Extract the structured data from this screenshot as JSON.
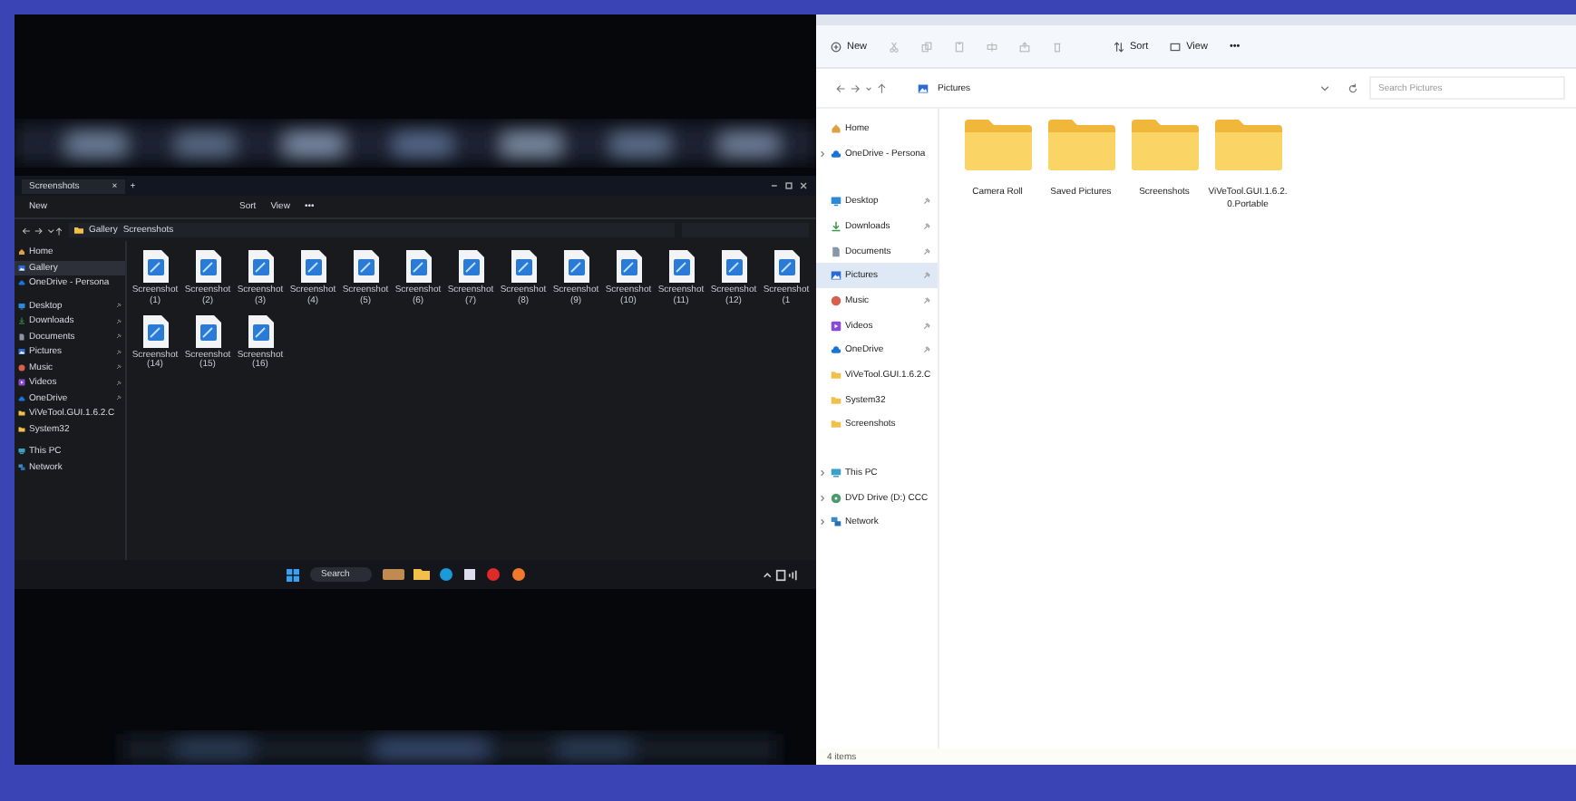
{
  "dark_window": {
    "tab": {
      "title": "Screenshots",
      "close": "×",
      "new_tab": "+"
    },
    "toolbar": {
      "new": "New",
      "sort": "Sort",
      "view": "View",
      "more": "•••"
    },
    "breadcrumb": [
      "Gallery",
      "Screenshots"
    ],
    "sidebar": {
      "groups": [
        {
          "items": [
            {
              "label": "Home",
              "kind": "home",
              "selected": false,
              "pinned": false,
              "expandable": false
            },
            {
              "label": "Gallery",
              "kind": "pictures",
              "selected": true,
              "pinned": false,
              "expandable": false
            },
            {
              "label": "OneDrive - Persona",
              "kind": "cloud",
              "selected": false,
              "pinned": false,
              "expandable": false
            }
          ]
        },
        {
          "items": [
            {
              "label": "Desktop",
              "kind": "desktop",
              "selected": false,
              "pinned": true,
              "expandable": false
            },
            {
              "label": "Downloads",
              "kind": "download",
              "selected": false,
              "pinned": true,
              "expandable": false
            },
            {
              "label": "Documents",
              "kind": "document",
              "selected": false,
              "pinned": true,
              "expandable": false
            },
            {
              "label": "Pictures",
              "kind": "pictures",
              "selected": false,
              "pinned": true,
              "expandable": false
            },
            {
              "label": "Music",
              "kind": "music",
              "selected": false,
              "pinned": true,
              "expandable": false
            },
            {
              "label": "Videos",
              "kind": "video",
              "selected": false,
              "pinned": true,
              "expandable": false
            },
            {
              "label": "OneDrive",
              "kind": "cloud",
              "selected": false,
              "pinned": true,
              "expandable": false
            },
            {
              "label": "ViVeTool.GUI.1.6.2.C",
              "kind": "folder",
              "selected": false,
              "pinned": false,
              "expandable": false
            },
            {
              "label": "System32",
              "kind": "folder",
              "selected": false,
              "pinned": false,
              "expandable": false
            }
          ]
        },
        {
          "items": [
            {
              "label": "This PC",
              "kind": "pc",
              "selected": false,
              "pinned": false,
              "expandable": false
            },
            {
              "label": "Network",
              "kind": "network",
              "selected": false,
              "pinned": false,
              "expandable": false
            }
          ]
        }
      ]
    },
    "file_rows": [
      {
        "files": [
          "Screenshot (1)",
          "Screenshot (2)",
          "Screenshot (3)",
          "Screenshot (4)",
          "Screenshot (5)",
          "Screenshot (6)",
          "Screenshot (7)",
          "Screenshot (8)",
          "Screenshot (9)",
          "Screenshot (10)",
          "Screenshot (11)",
          "Screenshot (12)",
          "Screenshot (1"
        ]
      },
      {
        "files": [
          "Screenshot (14)",
          "Screenshot (15)",
          "Screenshot (16)"
        ]
      }
    ],
    "taskbar": {
      "search": "Search"
    }
  },
  "explorer": {
    "toolbar": {
      "new": "New",
      "sort": "Sort",
      "view": "View",
      "more": "•••"
    },
    "address": {
      "crumbs": [
        "Pictures"
      ],
      "search_placeholder": "Search Pictures"
    },
    "sidebar": {
      "groups": [
        {
          "items": [
            {
              "label": "Home",
              "kind": "home",
              "selected": false,
              "pinned": false,
              "expandable": false
            },
            {
              "label": "OneDrive - Persona",
              "kind": "cloud",
              "selected": false,
              "pinned": false,
              "expandable": true
            }
          ]
        },
        {
          "items": [
            {
              "label": "Desktop",
              "kind": "desktop",
              "selected": false,
              "pinned": true,
              "expandable": false
            },
            {
              "label": "Downloads",
              "kind": "download",
              "selected": false,
              "pinned": true,
              "expandable": false
            },
            {
              "label": "Documents",
              "kind": "document",
              "selected": false,
              "pinned": true,
              "expandable": false
            },
            {
              "label": "Pictures",
              "kind": "pictures",
              "selected": true,
              "pinned": true,
              "expandable": false
            },
            {
              "label": "Music",
              "kind": "music",
              "selected": false,
              "pinned": true,
              "expandable": false
            },
            {
              "label": "Videos",
              "kind": "video",
              "selected": false,
              "pinned": true,
              "expandable": false
            },
            {
              "label": "OneDrive",
              "kind": "cloud",
              "selected": false,
              "pinned": true,
              "expandable": false
            },
            {
              "label": "ViVeTool.GUI.1.6.2.C",
              "kind": "folder",
              "selected": false,
              "pinned": false,
              "expandable": false
            },
            {
              "label": "System32",
              "kind": "folder",
              "selected": false,
              "pinned": false,
              "expandable": false
            },
            {
              "label": "Screenshots",
              "kind": "folder",
              "selected": false,
              "pinned": false,
              "expandable": false
            }
          ]
        },
        {
          "items": [
            {
              "label": "This PC",
              "kind": "pc",
              "selected": false,
              "pinned": false,
              "expandable": true
            },
            {
              "label": "DVD Drive (D:) CCC",
              "kind": "disc",
              "selected": false,
              "pinned": false,
              "expandable": true
            },
            {
              "label": "Network",
              "kind": "network",
              "selected": false,
              "pinned": false,
              "expandable": true
            }
          ]
        }
      ]
    },
    "folders": [
      {
        "name": "Camera Roll"
      },
      {
        "name": "Saved Pictures"
      },
      {
        "name": "Screenshots"
      },
      {
        "name": "ViVeTool.GUI.1.6.2.0.Portable"
      }
    ],
    "status": "4 items"
  }
}
